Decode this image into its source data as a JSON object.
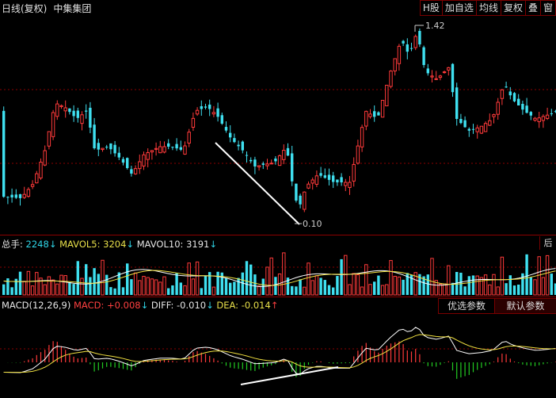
{
  "title": {
    "period": "日线(复权)",
    "stock_name": "中集集团"
  },
  "toolbar": [
    "H股",
    "加自选",
    "均线",
    "复权",
    "叠",
    "窗"
  ],
  "price_panel": {
    "high_label": "1.42",
    "low_label": "0.10"
  },
  "volume_panel": {
    "total_label": "总手:",
    "total_value": "2248",
    "mavol5_label": "MAVOL5:",
    "mavol5_value": "3204",
    "mavol10_label": "MAVOL10:",
    "mavol10_value": "3191",
    "corner": "后"
  },
  "macd_panel": {
    "name": "MACD(12,26,9)",
    "macd_label": "MACD:",
    "macd_value": "+0.008",
    "diff_label": "DIFF:",
    "diff_value": "-0.010",
    "dea_label": "DEA:",
    "dea_value": "-0.014",
    "btn_optimize": "优选参数",
    "btn_default": "默认参数"
  },
  "arrows": {
    "down": "↓",
    "up": "↑"
  },
  "colors": {
    "up": "#ff3a3a",
    "down": "#3fe0f0",
    "ma_white": "#ffffff",
    "ma_yellow": "#f0e040",
    "border": "#8b0000"
  }
}
